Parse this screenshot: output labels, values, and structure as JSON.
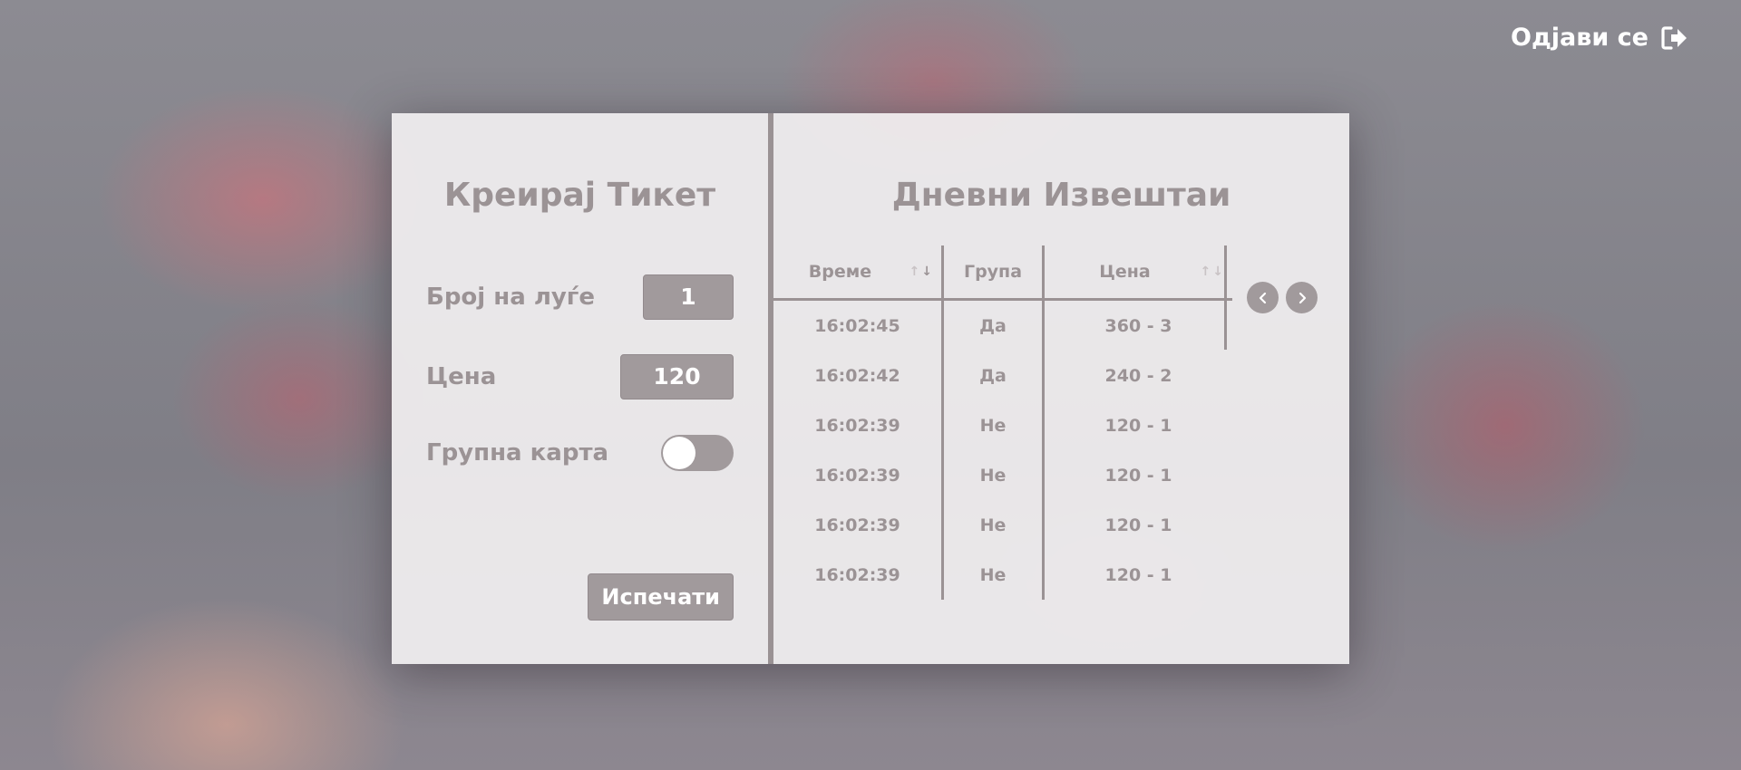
{
  "header": {
    "logout_label": "Одјави се"
  },
  "create_ticket": {
    "title": "Креирај Тикет",
    "people_label": "Број на луѓе",
    "people_value": "1",
    "price_label": "Цена",
    "price_value": "120",
    "group_label": "Групна карта",
    "group_enabled": false,
    "print_label": "Испечати"
  },
  "report": {
    "title": "Дневни Извештаи",
    "columns": [
      "Време",
      "Група",
      "Цена"
    ],
    "rows": [
      [
        "16:02:45",
        "Да",
        "360 - 3"
      ],
      [
        "16:02:42",
        "Да",
        "240 - 2"
      ],
      [
        "16:02:39",
        "Не",
        "120 - 1"
      ],
      [
        "16:02:39",
        "Не",
        "120 - 1"
      ],
      [
        "16:02:39",
        "Не",
        "120 - 1"
      ],
      [
        "16:02:39",
        "Не",
        "120 - 1"
      ]
    ]
  },
  "colors": {
    "accent": "#a19a9c",
    "text": "#9b9395",
    "panel": "#f4f2f3"
  },
  "icons": {
    "logout": "sign-out-icon",
    "prev": "chevron-left-icon",
    "next": "chevron-right-icon"
  }
}
